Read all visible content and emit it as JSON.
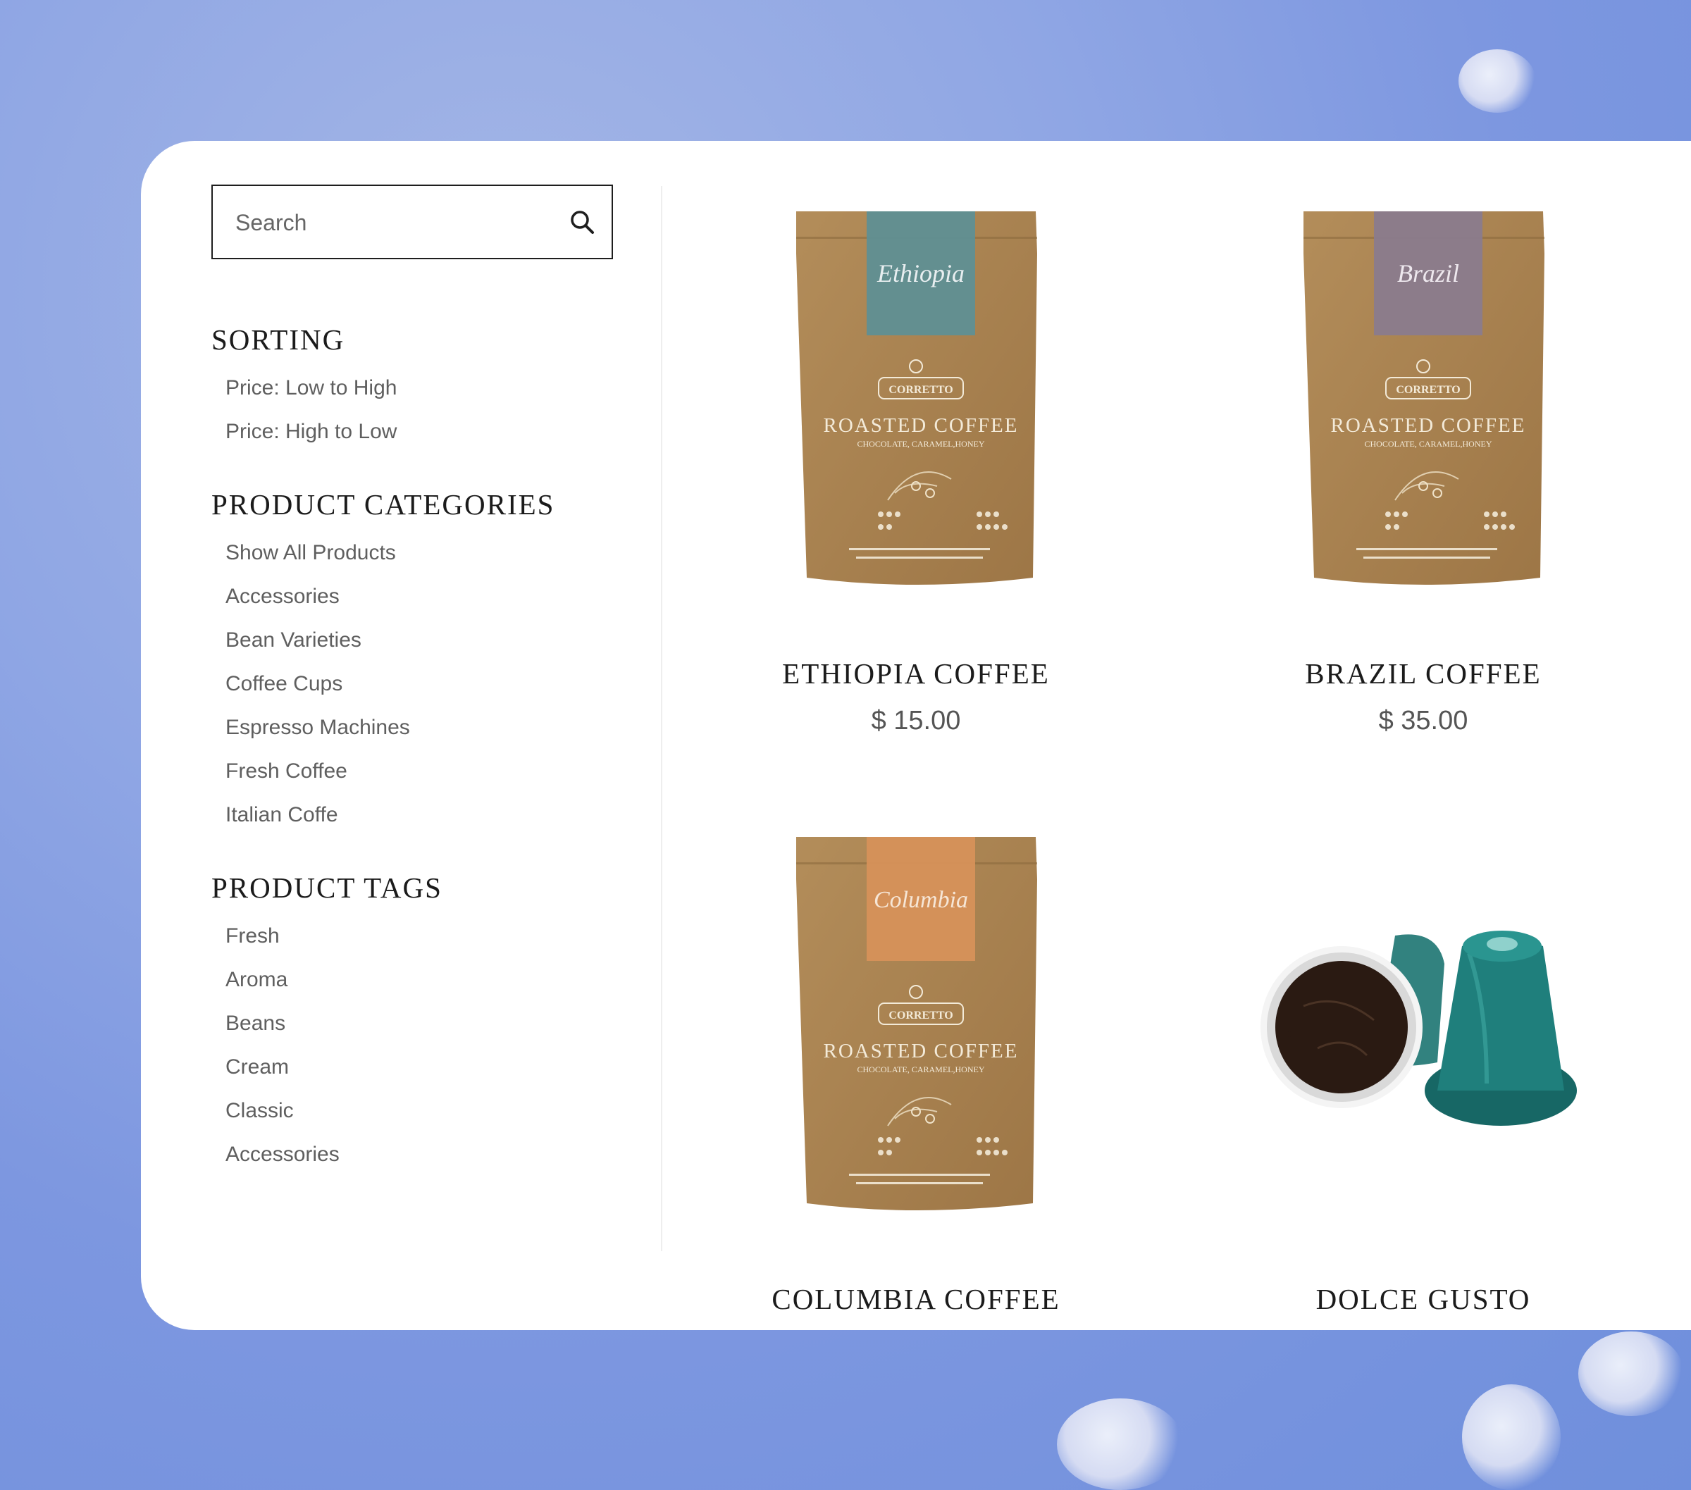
{
  "search": {
    "placeholder": "Search"
  },
  "sidebar": {
    "sorting": {
      "title": "SORTING",
      "items": [
        "Price: Low to High",
        "Price: High to Low"
      ]
    },
    "categories": {
      "title": "PRODUCT CATEGORIES",
      "items": [
        "Show All Products",
        "Accessories",
        "Bean Varieties",
        "Coffee Cups",
        "Espresso Machines",
        "Fresh Coffee",
        "Italian Coffe"
      ]
    },
    "tags": {
      "title": "PRODUCT TAGS",
      "items": [
        "Fresh",
        "Aroma",
        "Beans",
        "Cream",
        "Classic",
        "Accessories"
      ]
    }
  },
  "products": [
    {
      "name": "ETHIOPIA COFFEE",
      "price": "$ 15.00",
      "label": {
        "script": "Ethiopia",
        "brand": "CORRETTO",
        "title": "ROASTED COFFEE",
        "subtitle": "CHOCOLATE, CARAMEL,HONEY"
      },
      "label_color": "#5f8f93"
    },
    {
      "name": "BRAZIL COFFEE",
      "price": "$ 35.00",
      "label": {
        "script": "Brazil",
        "brand": "CORRETTO",
        "title": "ROASTED COFFEE",
        "subtitle": "CHOCOLATE, CARAMEL,HONEY"
      },
      "label_color": "#8a7b8d"
    },
    {
      "name": "COLUMBIA COFFEE",
      "label": {
        "script": "Columbia",
        "brand": "CORRETTO",
        "title": "ROASTED COFFEE",
        "subtitle": "CHOCOLATE, CARAMEL,HONEY"
      },
      "label_color": "#d6915a"
    },
    {
      "name": "DOLCE GUSTO",
      "capsule_color": "#1f7f7c"
    }
  ],
  "colors": {
    "bag": "#a9834f",
    "background": "#8fa6e4",
    "panel": "#ffffff"
  }
}
